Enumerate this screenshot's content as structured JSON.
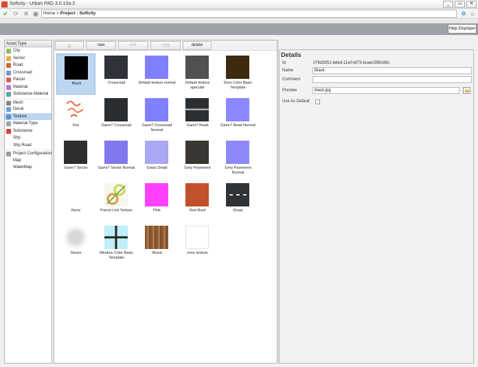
{
  "window": {
    "title": "Softcity - Urban PAD 3.0.10a.3",
    "min": "_",
    "max": "▭",
    "close": "✕"
  },
  "breadcrumb": {
    "home": "Home",
    "sep": " > ",
    "current": "Project : Softcity"
  },
  "help_button": "Help Displayer",
  "sidebar": {
    "header": "Asset Type",
    "items": [
      {
        "label": "City",
        "color": "#8fbf5a"
      },
      {
        "label": "Sector",
        "color": "#e8b04a"
      },
      {
        "label": "Road",
        "color": "#c86a3a"
      },
      {
        "label": "Crossroad",
        "color": "#7a9ad0"
      },
      {
        "label": "Parcel",
        "color": "#d95c5c"
      },
      {
        "label": "Material",
        "color": "#b47ad0"
      },
      {
        "label": "Substance Material",
        "color": "#60a8a0"
      },
      {
        "label": "Mesh",
        "color": "#888888"
      },
      {
        "label": "Decal",
        "color": "#6aa0d8"
      },
      {
        "label": "Texture",
        "color": "#5a8fd8",
        "selected": true
      },
      {
        "label": "Material Type",
        "color": "#a0a0a0"
      },
      {
        "label": "Substance",
        "color": "#d04040"
      },
      {
        "label": "Shp",
        "color": ""
      },
      {
        "label": "Shp Road",
        "color": ""
      },
      {
        "label": "Project Configuration",
        "color": "#9a9a9a"
      },
      {
        "label": "Map",
        "color": ""
      },
      {
        "label": "WaterMap",
        "color": ""
      }
    ]
  },
  "actions": {
    "home": "⌂",
    "new": "new",
    "edit": "edit",
    "copy": "copy",
    "delete": "delete"
  },
  "textures": [
    {
      "label": "Black",
      "color": "#000000",
      "selected": true
    },
    {
      "label": "Crossroad",
      "color": "#2d3338"
    },
    {
      "label": "Default texture normal",
      "color": "#8080ff"
    },
    {
      "label": "Default texture specular",
      "color": "#505050"
    },
    {
      "label": "Door Color Basic Template",
      "color": "#3e2a10"
    },
    {
      "label": "Fire",
      "color": "fire"
    },
    {
      "label": "Gamr7 Crossroad",
      "color": "#2a2d30"
    },
    {
      "label": "Gamr7 Crossroad Normal",
      "color": "#8080ff"
    },
    {
      "label": "Gamr7 Road",
      "color": "road-gamr7"
    },
    {
      "label": "Gamr7 Road Normal",
      "color": "#8a88ff"
    },
    {
      "label": "Gamr7 Sector",
      "color": "#2e2e2e"
    },
    {
      "label": "Gamr7 Sector Normal",
      "color": "#8078ee"
    },
    {
      "label": "Grass Detail",
      "color": "#a8a8f4"
    },
    {
      "label": "Grey Pavement",
      "color": "#3a3632"
    },
    {
      "label": "Grey Pavement Normal",
      "color": "#8c88f8"
    },
    {
      "label": "None",
      "color": ""
    },
    {
      "label": "Parcel Link Texture",
      "color": "parcel"
    },
    {
      "label": "Pink",
      "color": "#ff40ff"
    },
    {
      "label": "Red Roof",
      "color": "#c2502a"
    },
    {
      "label": "Road",
      "color": "road"
    },
    {
      "label": "Steam",
      "color": "steam"
    },
    {
      "label": "Window Color Basic Template",
      "color": "window"
    },
    {
      "label": "Wood",
      "color": "wood"
    },
    {
      "label": "error texture",
      "color": "#ffffff"
    }
  ],
  "details": {
    "title": "Details",
    "id_label": "Id",
    "id_value": "076d3051-bded-11e0-bf73-bcaec599166c",
    "name_label": "Name",
    "name_value": "Black",
    "comment_label": "Comment",
    "comment_value": "",
    "preview_label": "Preview",
    "preview_value": "black.jpg",
    "default_label": "Use As Default"
  }
}
